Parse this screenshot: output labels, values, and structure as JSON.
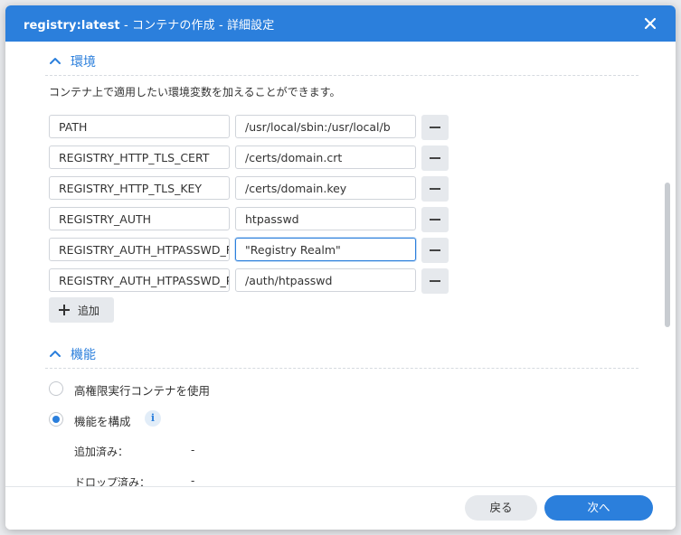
{
  "dialog": {
    "title_main": "registry:latest",
    "title_sub": " - コンテナの作成 - 詳細設定",
    "close_icon": "close-icon"
  },
  "environment": {
    "header": "環境",
    "description": "コンテナ上で適用したい環境変数を加えることができます。",
    "rows": [
      {
        "name": "PATH",
        "value": "/usr/local/sbin:/usr/local/b"
      },
      {
        "name": "REGISTRY_HTTP_TLS_CERT",
        "value": "/certs/domain.crt"
      },
      {
        "name": "REGISTRY_HTTP_TLS_KEY",
        "value": "/certs/domain.key"
      },
      {
        "name": "REGISTRY_AUTH",
        "value": "htpasswd"
      },
      {
        "name": "REGISTRY_AUTH_HTPASSWD_REALM",
        "value": "\"Registry Realm\""
      },
      {
        "name": "REGISTRY_AUTH_HTPASSWD_PATH",
        "value": "/auth/htpasswd"
      }
    ],
    "add_label": "追加"
  },
  "capabilities": {
    "header": "機能",
    "options": [
      {
        "label": "高権限実行コンテナを使用",
        "checked": false
      },
      {
        "label": "機能を構成",
        "checked": true
      }
    ],
    "info_icon": "info-icon",
    "added_label": "追加済み：",
    "added_value": "-",
    "dropped_label": "ドロップ済み：",
    "dropped_value": "-"
  },
  "footer": {
    "back_label": "戻る",
    "next_label": "次へ"
  },
  "colors": {
    "accent": "#2b7fdc",
    "button_gray": "#e6e9ed"
  }
}
